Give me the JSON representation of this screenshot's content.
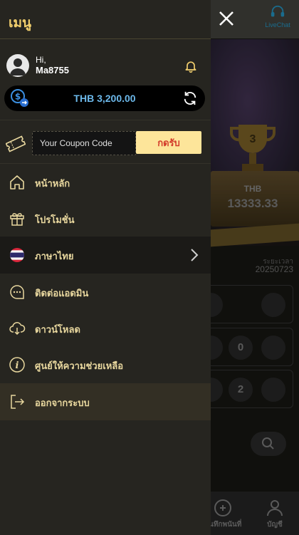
{
  "drawer": {
    "title": "เมนู",
    "greeting": "Hi,",
    "username": "Ma8755",
    "balance": "THB 3,200.00",
    "coupon": {
      "placeholder": "Your Coupon Code",
      "submit_label": "กดรับ"
    },
    "menu": [
      {
        "label": "หน้าหลัก",
        "icon": "home-icon"
      },
      {
        "label": "โปรโมชั่น",
        "icon": "gift-icon"
      },
      {
        "label": "ภาษาไทย",
        "icon": "thai-flag-icon"
      },
      {
        "label": "ติดต่อแอดมิน",
        "icon": "chat-icon"
      },
      {
        "label": "ดาวน์โหลด",
        "icon": "cloud-download-icon"
      },
      {
        "label": "ศูนย์ให้ความช่วยเหลือ",
        "icon": "info-icon"
      }
    ],
    "logout_label": "ออกจากระบบ"
  },
  "background": {
    "livechat_label": "LiveChat",
    "prize_currency": "THB",
    "prize_amount": "13333.33",
    "draw_time_label": "ระยะเวลา",
    "draw_time_value": "20250723",
    "draw_rows": [
      {
        "balls": [
          "",
          ""
        ]
      },
      {
        "balls": [
          "",
          "0",
          ""
        ]
      },
      {
        "balls": [
          "",
          "2",
          ""
        ]
      }
    ],
    "bottom_nav": [
      {
        "label": "บันทึกพนันที่",
        "icon": "bet-record-icon"
      },
      {
        "label": "บัญชี",
        "icon": "account-icon"
      }
    ]
  },
  "colors": {
    "accent_gold": "#f2cf6d",
    "menu_text": "#e8d79e",
    "balance_blue": "#6cb8ea",
    "coupon_button_bg": "#fde59a",
    "coupon_button_text": "#d23a2a"
  }
}
